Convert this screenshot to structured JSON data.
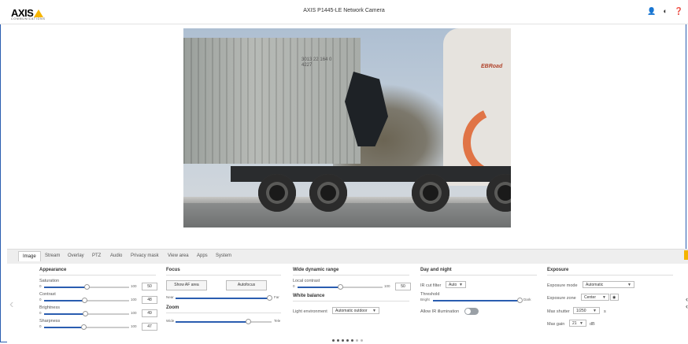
{
  "header": {
    "logo_text": "AXIS",
    "logo_sub": "COMMUNICATIONS",
    "title": "AXIS P1445-LE Network Camera",
    "icons": [
      "user-icon",
      "contrast-icon",
      "help-icon"
    ]
  },
  "video": {
    "container_code_line1": "3013 22 164 0",
    "container_code_line2": "4227",
    "cab_text": "EBRoad"
  },
  "tabs": [
    {
      "label": "Image"
    },
    {
      "label": "Stream"
    },
    {
      "label": "Overlay"
    },
    {
      "label": "PTZ"
    },
    {
      "label": "Audio"
    },
    {
      "label": "Privacy mask"
    },
    {
      "label": "View area"
    },
    {
      "label": "Apps"
    },
    {
      "label": "System"
    }
  ],
  "appearance": {
    "heading": "Appearance",
    "saturation": {
      "label": "Saturation",
      "min": "0",
      "max": "100",
      "value": "50"
    },
    "contrast": {
      "label": "Contrast",
      "min": "0",
      "max": "100",
      "value": "48"
    },
    "brightness": {
      "label": "Brightness",
      "min": "0",
      "max": "100",
      "value": "49"
    },
    "sharpness": {
      "label": "Sharpness",
      "min": "0",
      "max": "100",
      "value": "47"
    }
  },
  "focus": {
    "heading": "Focus",
    "show_af_area": "Show AF area",
    "autofocus": "Autofocus",
    "near": "Near",
    "far": "Far",
    "zoom_heading": "Zoom",
    "wide": "Wide",
    "tele": "Tele"
  },
  "wdr": {
    "heading": "Wide dynamic range",
    "local_contrast": {
      "label": "Local contrast",
      "min": "0",
      "max": "100",
      "value": "50"
    },
    "wb_heading": "White balance",
    "light_env_label": "Light environment",
    "light_env_value": "Automatic outdoor"
  },
  "daynight": {
    "heading": "Day and night",
    "ir_cut_label": "IR cut filter",
    "ir_cut_value": "Auto",
    "threshold_label": "Threshold",
    "bright": "Bright",
    "dark": "Dark",
    "allow_ir_label": "Allow IR illumination"
  },
  "exposure": {
    "heading": "Exposure",
    "mode_label": "Exposure mode",
    "mode_value": "Automatic",
    "zone_label": "Exposure zone",
    "zone_value": "Center",
    "shutter_label": "Max shutter",
    "shutter_value": "1/250",
    "shutter_unit": "s",
    "gain_label": "Max gain",
    "gain_value": "21",
    "gain_unit": "dB"
  },
  "levels": {
    "saturation": 0.5,
    "contrast": 0.48,
    "brightness": 0.49,
    "sharpness": 0.47,
    "focus": 0.98,
    "zoom": 0.76,
    "local_contrast": 0.5,
    "threshold": 1.0
  },
  "colors": {
    "accent": "#2a5db0",
    "brand_yellow": "#f7b500"
  }
}
